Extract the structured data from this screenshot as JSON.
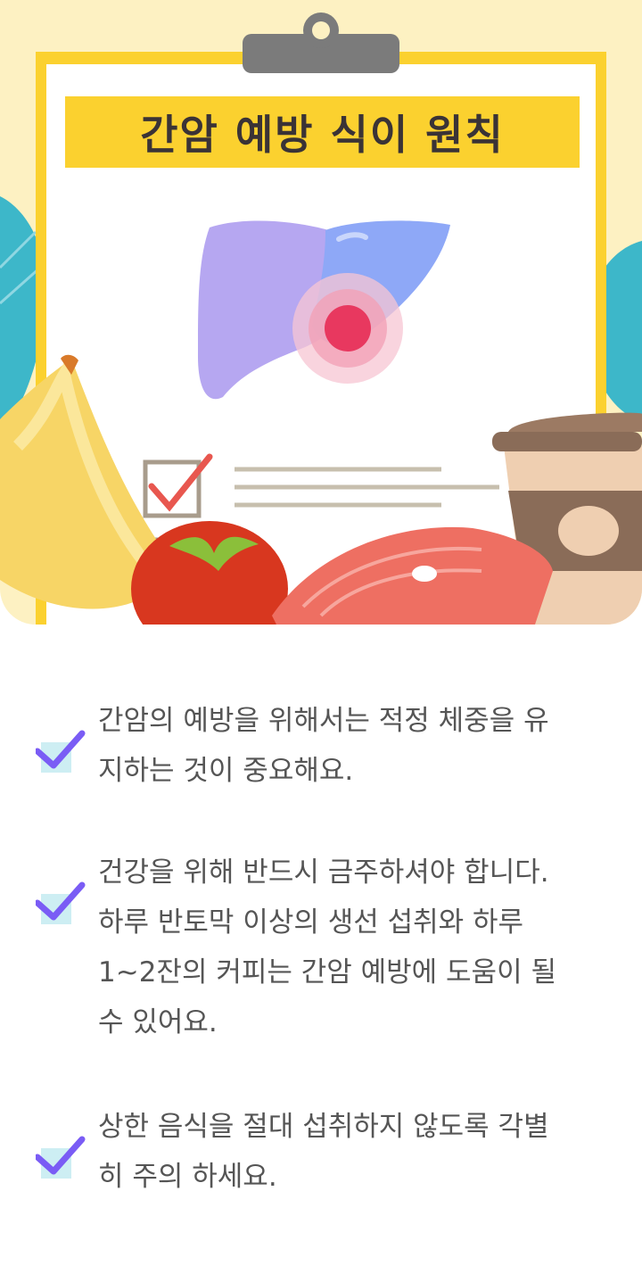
{
  "title": "간암 예방 식이 원칙",
  "accent_color": "#fbd12f",
  "check_color": "#7a5cf5",
  "check_bg_color": "#cdeef3",
  "items": [
    {
      "text": "간암의 예방을 위해서는 적정 체중을 유\n지하는 것이 중요해요."
    },
    {
      "text": "건강을 위해 반드시 금주하셔야 합니다.\n하루 반토막 이상의 생선 섭취와 하루\n1~2잔의 커피는 간암 예방에 도움이 될\n수 있어요."
    },
    {
      "text": "상한 음식을 절대 섭취하지 않도록 각별\n히 주의 하세요."
    }
  ]
}
